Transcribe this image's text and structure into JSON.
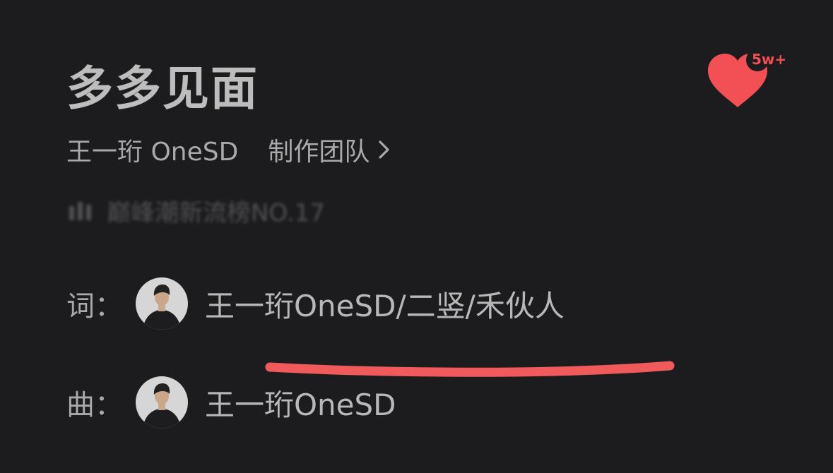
{
  "song": {
    "title": "多多见面",
    "artist": "王一珩 OneSD",
    "team_label": "制作团队",
    "like_count": "5w+",
    "chart_rank": "巅峰潮新流榜NO.17"
  },
  "credits": [
    {
      "role": "词：",
      "names": "王一珩OneSD/二竖/禾伙人"
    },
    {
      "role": "曲：",
      "names": "王一珩OneSD"
    }
  ],
  "colors": {
    "background": "#1c1c1e",
    "like_red": "#f25055",
    "annotation_red": "#f05a5a"
  },
  "icons": [
    "heart-icon",
    "chevron-right-icon",
    "chart-bars-icon",
    "avatar"
  ]
}
